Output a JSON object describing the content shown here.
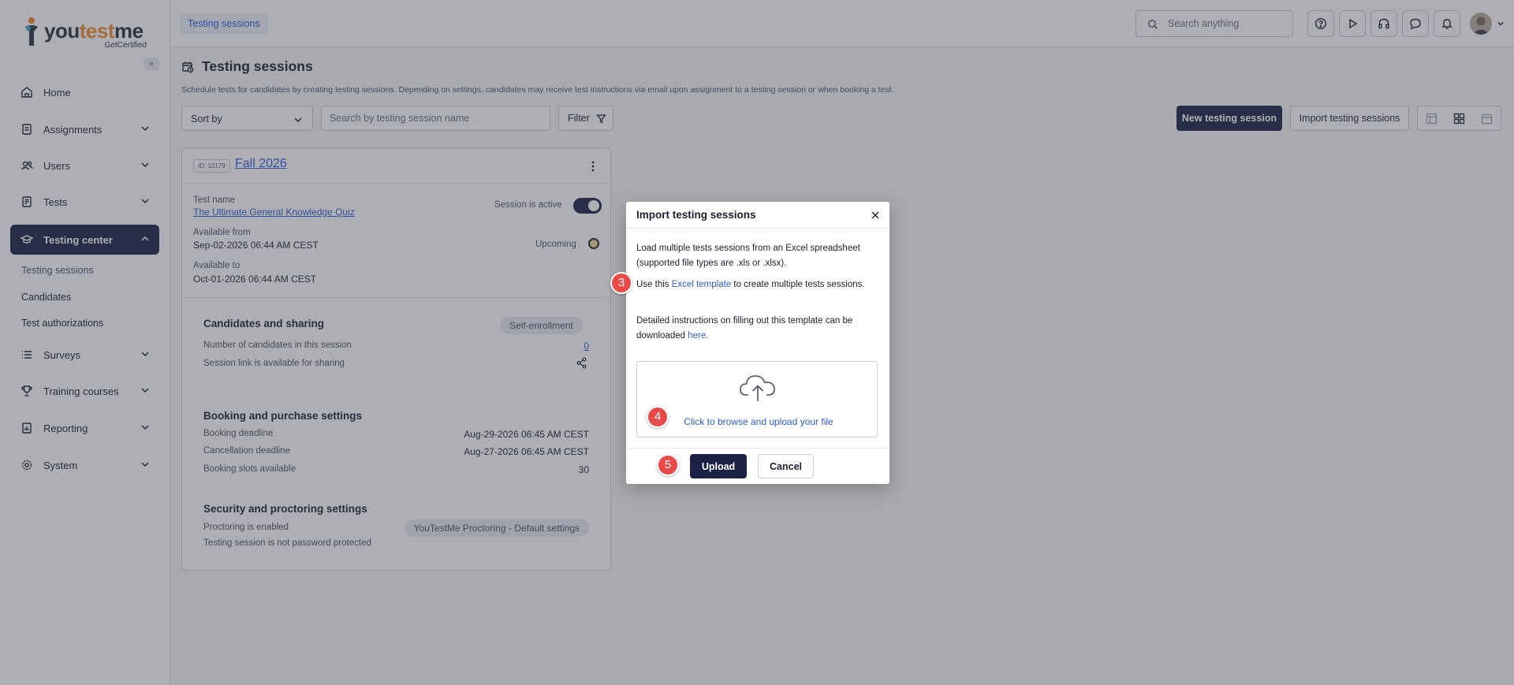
{
  "brand": {
    "name_part1": "you",
    "name_part2": "test",
    "name_part3": "me",
    "sub": "GetCertified"
  },
  "sidebar": {
    "collapse_label": "«",
    "items": [
      {
        "label": "Home",
        "icon": "home-icon"
      },
      {
        "label": "Assignments",
        "icon": "assignment-icon"
      },
      {
        "label": "Users",
        "icon": "users-icon"
      },
      {
        "label": "Tests",
        "icon": "tests-icon"
      },
      {
        "label": "Testing center",
        "icon": "testing-center-icon"
      },
      {
        "label": "Surveys",
        "icon": "surveys-icon"
      },
      {
        "label": "Training courses",
        "icon": "trophy-icon"
      },
      {
        "label": "Reporting",
        "icon": "reporting-icon"
      },
      {
        "label": "System",
        "icon": "gear-icon"
      }
    ],
    "sub_items": [
      {
        "label": "Testing sessions"
      },
      {
        "label": "Candidates"
      },
      {
        "label": "Test authorizations"
      }
    ]
  },
  "topbar": {
    "breadcrumb": "Testing sessions",
    "search_placeholder": "Search anything"
  },
  "page": {
    "title": "Testing sessions",
    "description": "Schedule tests for candidates by creating testing sessions. Depending on settings, candidates may receive test instructions via email upon assignment to a testing session or when booking a test.",
    "sort_label": "Sort by",
    "search_placeholder": "Search by testing session name",
    "filter_label": "Filter",
    "new_session_label": "New testing session",
    "import_label": "Import testing sessions"
  },
  "card": {
    "id_badge": "ID: 10179",
    "title": "Fall 2026",
    "test_name_label": "Test name",
    "test_name": "The Ultimate General Knowledge Quiz",
    "session_active_label": "Session is active",
    "available_from_label": "Available from",
    "available_from": "Sep-02-2026 06:44 AM CEST",
    "status": "Upcoming",
    "available_to_label": "Available to",
    "available_to": "Oct-01-2026 06:44 AM CEST",
    "candidates_title": "Candidates and sharing",
    "enrollment_badge": "Self-enrollment",
    "num_candidates_label": "Number of candidates in this session",
    "num_candidates": "0",
    "session_link_label": "Session link is available for sharing",
    "booking_title": "Booking and purchase settings",
    "booking_deadline_label": "Booking deadline",
    "booking_deadline": "Aug-29-2026 06:45 AM CEST",
    "cancellation_deadline_label": "Cancellation deadline",
    "cancellation_deadline": "Aug-27-2026 06:45 AM CEST",
    "booking_slots_label": "Booking slots available",
    "booking_slots": "30",
    "security_title": "Security and proctoring settings",
    "proctoring_label": "Proctoring is enabled",
    "proctoring_badge": "YouTestMe Proctoring - Default settings",
    "password_label": "Testing session is not password protected"
  },
  "modal": {
    "title": "Import testing sessions",
    "para1": "Load multiple tests sessions from an Excel spreadsheet (supported file types are .xls or .xlsx).",
    "para2_before": "Use this ",
    "para2_link": "Excel template",
    "para2_after": " to create multiple tests sessions.",
    "para3_before": "Detailed instructions on filling out this template can be downloaded ",
    "para3_link": "here",
    "para3_after": ".",
    "dropzone_text": "Click to browse and upload your file",
    "upload_label": "Upload",
    "cancel_label": "Cancel"
  },
  "steps": {
    "s3": "3",
    "s4": "4",
    "s5": "5"
  },
  "colors": {
    "primary": "#1b2245",
    "link": "#2d5bd7",
    "step": "#e84a4a",
    "brand_accent": "#f28c28"
  }
}
